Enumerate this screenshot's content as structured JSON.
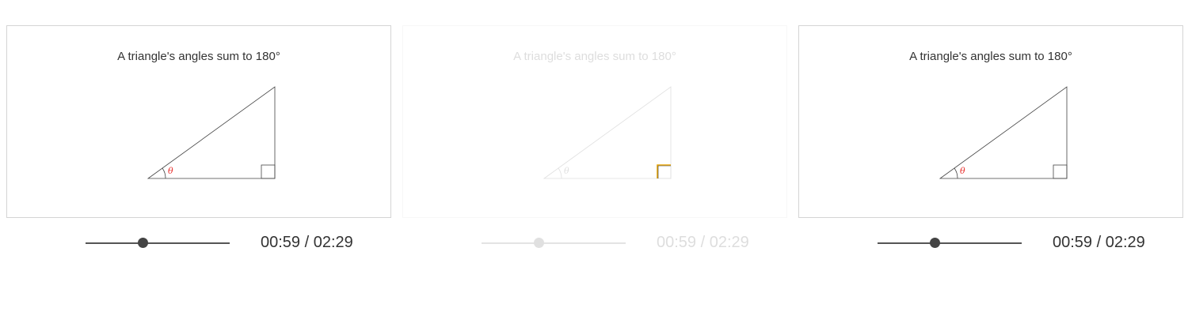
{
  "players": [
    {
      "caption": "A triangle's angles sum to 180°",
      "angle_symbol": "θ",
      "time_display": "00:59 / 02:29",
      "progress_fraction": 0.3959,
      "state": "normal"
    },
    {
      "caption": "A triangle's angles sum to 180°",
      "angle_symbol": "θ",
      "time_display": "00:59 / 02:29",
      "progress_fraction": 0.3959,
      "state": "faded",
      "highlight": "right-angle-marker"
    },
    {
      "caption": "A triangle's angles sum to 180°",
      "angle_symbol": "θ",
      "time_display": "00:59 / 02:29",
      "progress_fraction": 0.3959,
      "state": "normal"
    }
  ],
  "colors": {
    "angle_label": "#e8312e",
    "highlight": "#e8a400",
    "line": "#333333",
    "frame_border": "#d4d4d4"
  }
}
